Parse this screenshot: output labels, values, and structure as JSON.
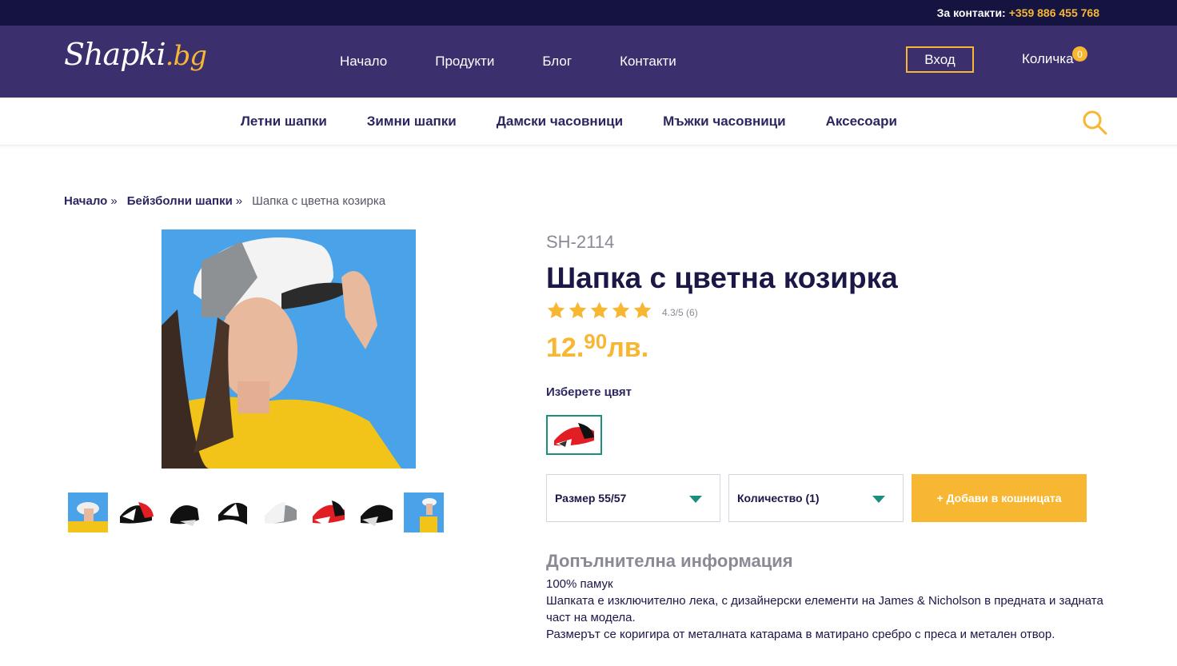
{
  "topbar": {
    "contacts_label": "За контакти:",
    "phone": "+359 886 455 768"
  },
  "header": {
    "logo_main": "Shapki",
    "logo_tld": ".bg",
    "nav": [
      "Начало",
      "Продукти",
      "Блог",
      "Контакти"
    ],
    "login_label": "Вход",
    "cart_label": "Количка",
    "cart_count": "0"
  },
  "catnav": [
    "Летни шапки",
    "Зимни шапки",
    "Дамски часовници",
    "Мъжки часовници",
    "Аксесоари"
  ],
  "breadcrumb": {
    "home": "Начало",
    "sep": "»",
    "category": "Бейзболни шапки",
    "current": "Шапка с цветна козирка"
  },
  "product": {
    "sku": "SH-2114",
    "title": "Шапка с цветна козирка",
    "rating": 5,
    "rating_text": "4.3/5 (6)",
    "price_main": "12.",
    "price_cents": "90",
    "price_currency": "лв.",
    "color_label": "Изберете цвят",
    "size_select": "Размер 55/57",
    "qty_select": "Количество (1)",
    "add_to_cart": "+ Добави в кошницата"
  },
  "info": {
    "title": "Допълнителна информация",
    "lines": [
      "100% памук",
      "Шапката е изключително лека, с дизайнерски елементи на James & Nicholson в предната и задната част на модела.",
      "Размерът се коригира от металната катарама в матирано сребро с преса и метален отвор."
    ]
  },
  "colors": {
    "accent": "#f7b733",
    "header_bg": "#3b2f6e",
    "topbar_bg": "#15133f",
    "teal": "#1a8f7e"
  }
}
